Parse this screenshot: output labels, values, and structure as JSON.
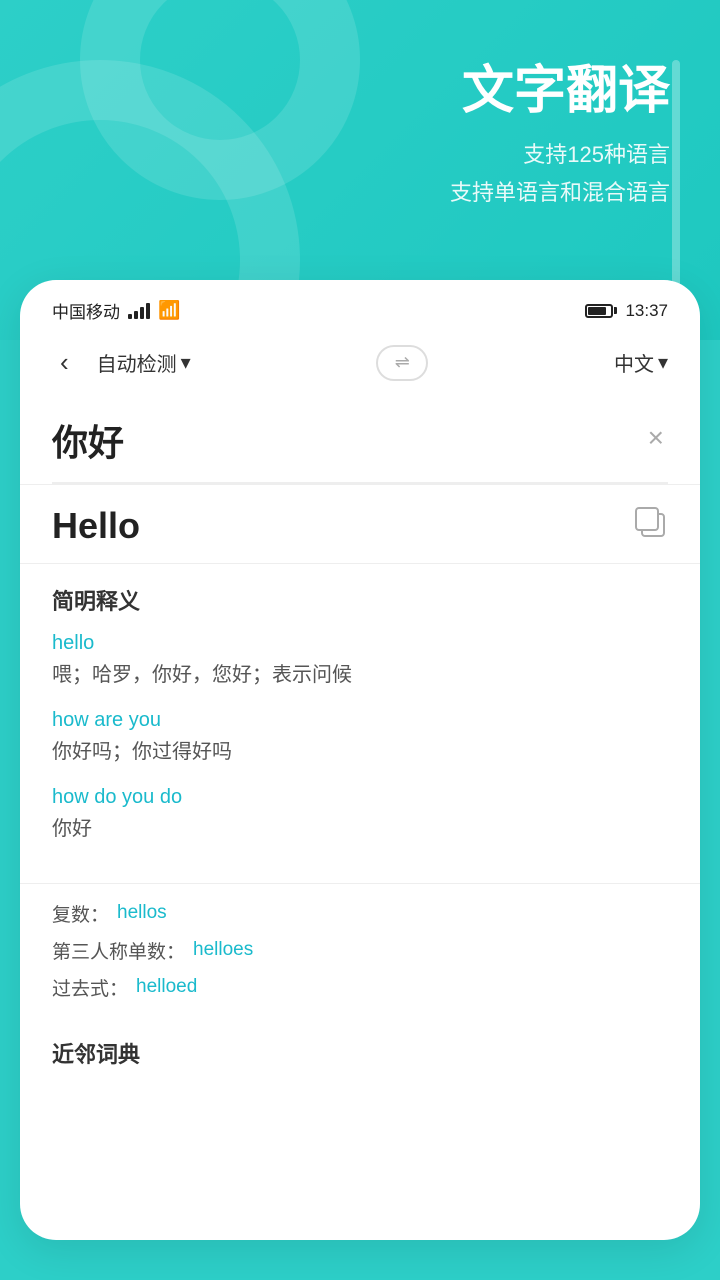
{
  "background": {
    "title": "文字翻译",
    "subtitle_line1": "支持125种语言",
    "subtitle_line2": "支持单语言和混合语言"
  },
  "status_bar": {
    "carrier": "中国移动",
    "time": "13:37"
  },
  "nav": {
    "back_label": "‹",
    "lang_from": "自动检测",
    "lang_from_arrow": "▾",
    "swap_icon": "⇌",
    "lang_to": "中文",
    "lang_to_arrow": "▾"
  },
  "input": {
    "text": "你好",
    "clear_icon": "×"
  },
  "result": {
    "text": "Hello",
    "copy_label": "copy"
  },
  "definitions": {
    "section_title": "简明释义",
    "entries": [
      {
        "term": "hello",
        "meaning": "喂；哈罗，你好，您好；表示问候"
      },
      {
        "term": "how are you",
        "meaning": "你好吗；你过得好吗"
      },
      {
        "term": "how do you do",
        "meaning": "你好"
      }
    ]
  },
  "forms": {
    "plural_label": "复数：",
    "plural_value": "hellos",
    "third_person_label": "第三人称单数：",
    "third_person_value": "helloes",
    "past_label": "过去式：",
    "past_value": "helloed"
  },
  "related_title": "近邻词典"
}
